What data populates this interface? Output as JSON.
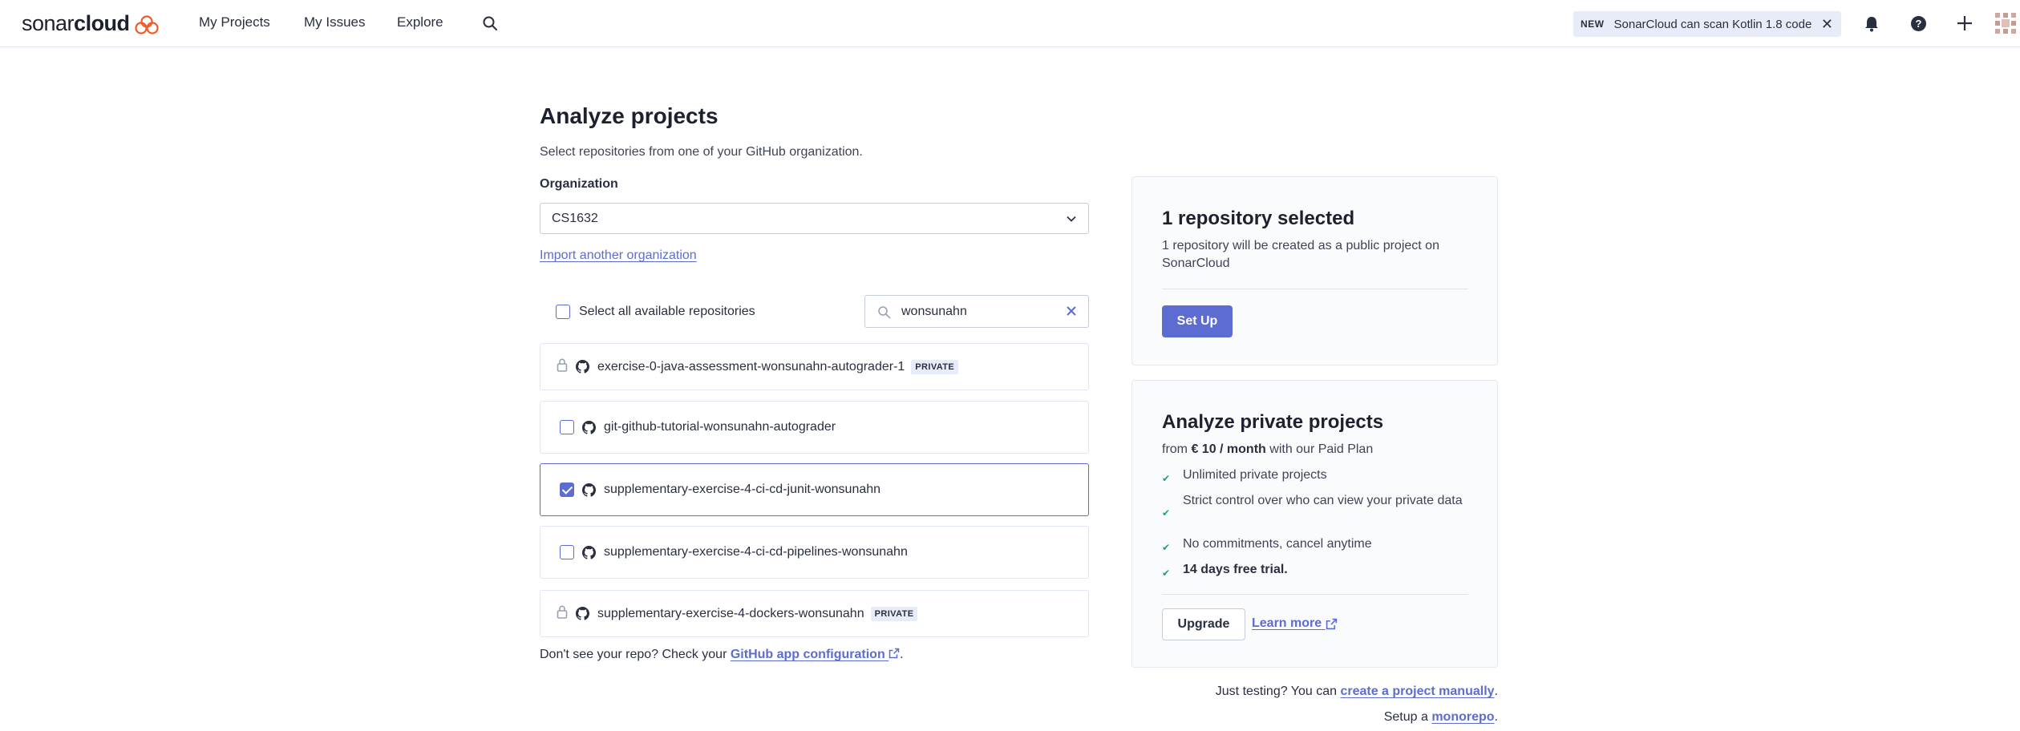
{
  "nav": {
    "brand_light": "sonar",
    "brand_bold": "cloud",
    "links": [
      "My Projects",
      "My Issues",
      "Explore"
    ],
    "news_badge": "NEW",
    "news_text": "SonarCloud can scan Kotlin 1.8 code"
  },
  "main": {
    "title": "Analyze projects",
    "subtitle": "Select repositories from one of your GitHub organization.",
    "org_label": "Organization",
    "org_value": "CS1632",
    "import_link": "Import another organization",
    "select_all_label": "Select all available repositories",
    "search_value": "wonsunahn",
    "repos": [
      {
        "name": "exercise-0-java-assessment-wonsunahn-autograder-1",
        "private": true,
        "badge": "PRIVATE",
        "checked": false
      },
      {
        "name": "git-github-tutorial-wonsunahn-autograder",
        "private": false,
        "badge": "",
        "checked": false
      },
      {
        "name": "supplementary-exercise-4-ci-cd-junit-wonsunahn",
        "private": false,
        "badge": "",
        "checked": true
      },
      {
        "name": "supplementary-exercise-4-ci-cd-pipelines-wonsunahn",
        "private": false,
        "badge": "",
        "checked": false
      },
      {
        "name": "supplementary-exercise-4-dockers-wonsunahn",
        "private": true,
        "badge": "PRIVATE",
        "checked": false
      }
    ],
    "dont_see_prefix": "Don't see your repo? Check your ",
    "dont_see_link": "GitHub app configuration",
    "dont_see_suffix": "."
  },
  "selection_card": {
    "title": "1 repository selected",
    "text": "1 repository will be created as a public project on SonarCloud",
    "button": "Set Up"
  },
  "private_card": {
    "title": "Analyze private projects",
    "price_prefix": "from ",
    "price": "€ 10 / month",
    "price_suffix": " with our Paid Plan",
    "features": [
      "Unlimited private projects",
      "Strict control over who can view your private data",
      "No commitments, cancel anytime",
      "14 days free trial."
    ],
    "upgrade_button": "Upgrade",
    "learn_more": "Learn more"
  },
  "footer_notes": {
    "manual_prefix": "Just testing? You can ",
    "manual_link": "create a project manually",
    "manual_suffix": ".",
    "mono_prefix": "Setup a ",
    "mono_link": "monorepo",
    "mono_suffix": "."
  },
  "colors": {
    "accent": "#5d6cd0",
    "success": "#1aa372",
    "logo": "#f05a28"
  }
}
